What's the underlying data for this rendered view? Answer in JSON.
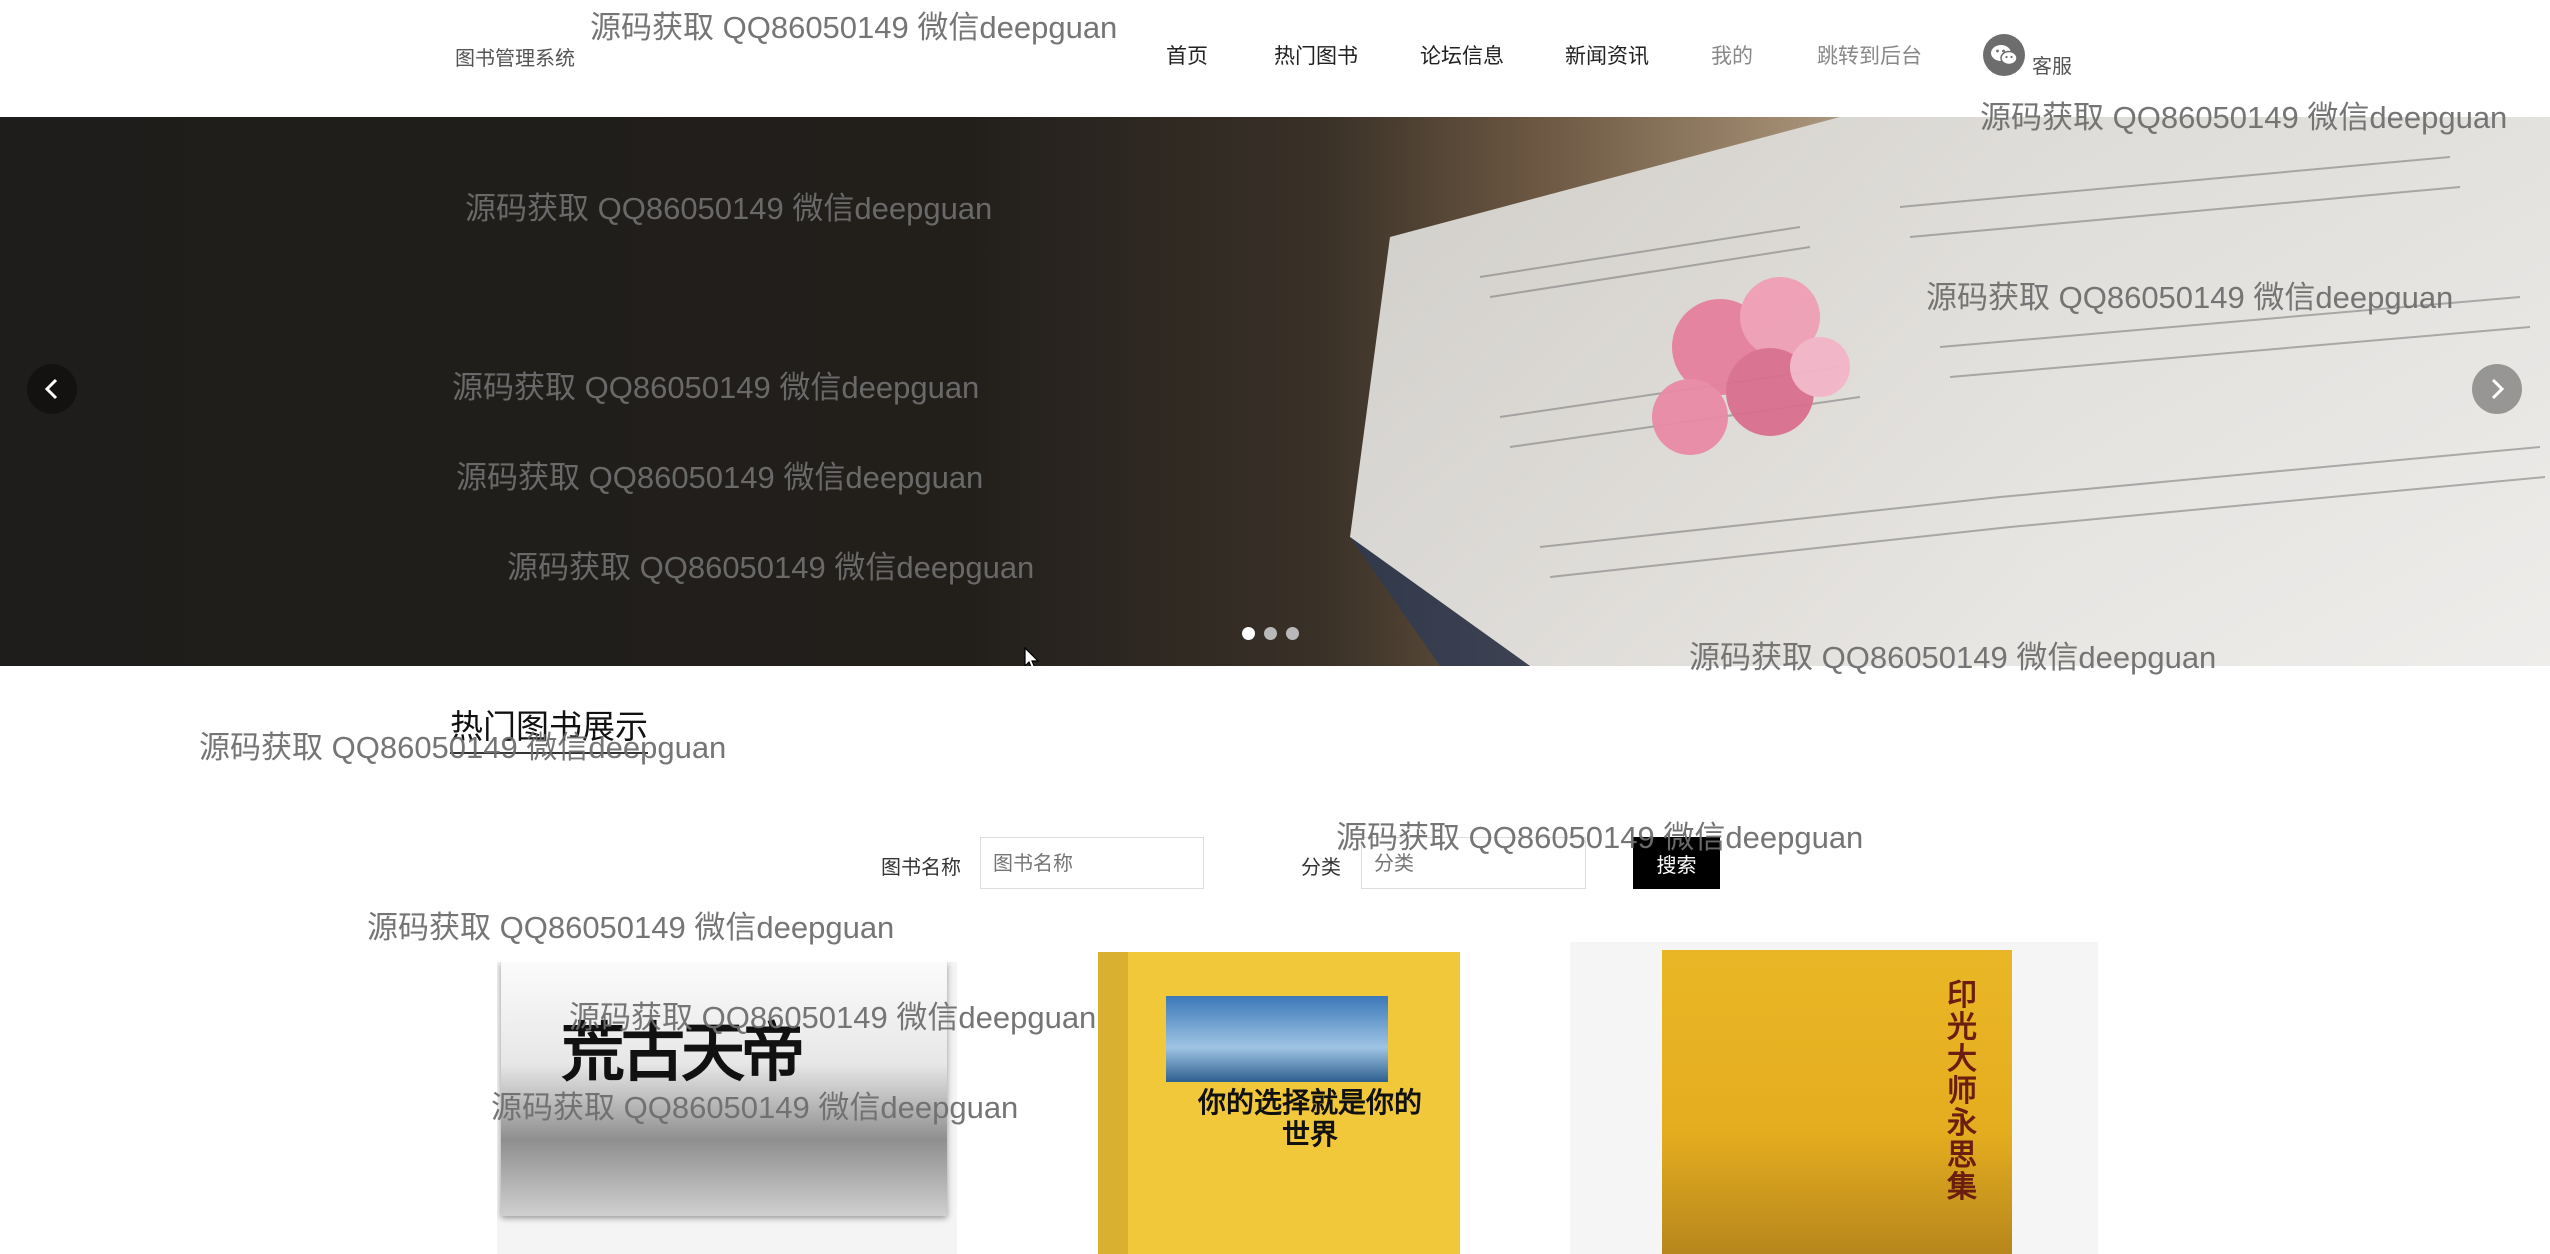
{
  "header": {
    "brand": "图书管理系统",
    "nav": [
      {
        "label": "首页"
      },
      {
        "label": "热门图书"
      },
      {
        "label": "论坛信息"
      },
      {
        "label": "新闻资讯"
      },
      {
        "label": "我的"
      },
      {
        "label": "跳转到后台"
      }
    ],
    "service_label": "客服"
  },
  "banner": {
    "slide_count": 3,
    "active_slide": 1
  },
  "section": {
    "title": "热门图书展示"
  },
  "search": {
    "name_label": "图书名称",
    "name_placeholder": "图书名称",
    "category_label": "分类",
    "category_placeholder": "分类",
    "button_label": "搜索"
  },
  "books": [
    {
      "cover_title": "荒古天帝"
    },
    {
      "cover_title": "你的选择就是你的世界"
    },
    {
      "cover_title": "印光大师永思集"
    }
  ],
  "watermark_text": "源码获取 QQ86050149 微信deepguan"
}
